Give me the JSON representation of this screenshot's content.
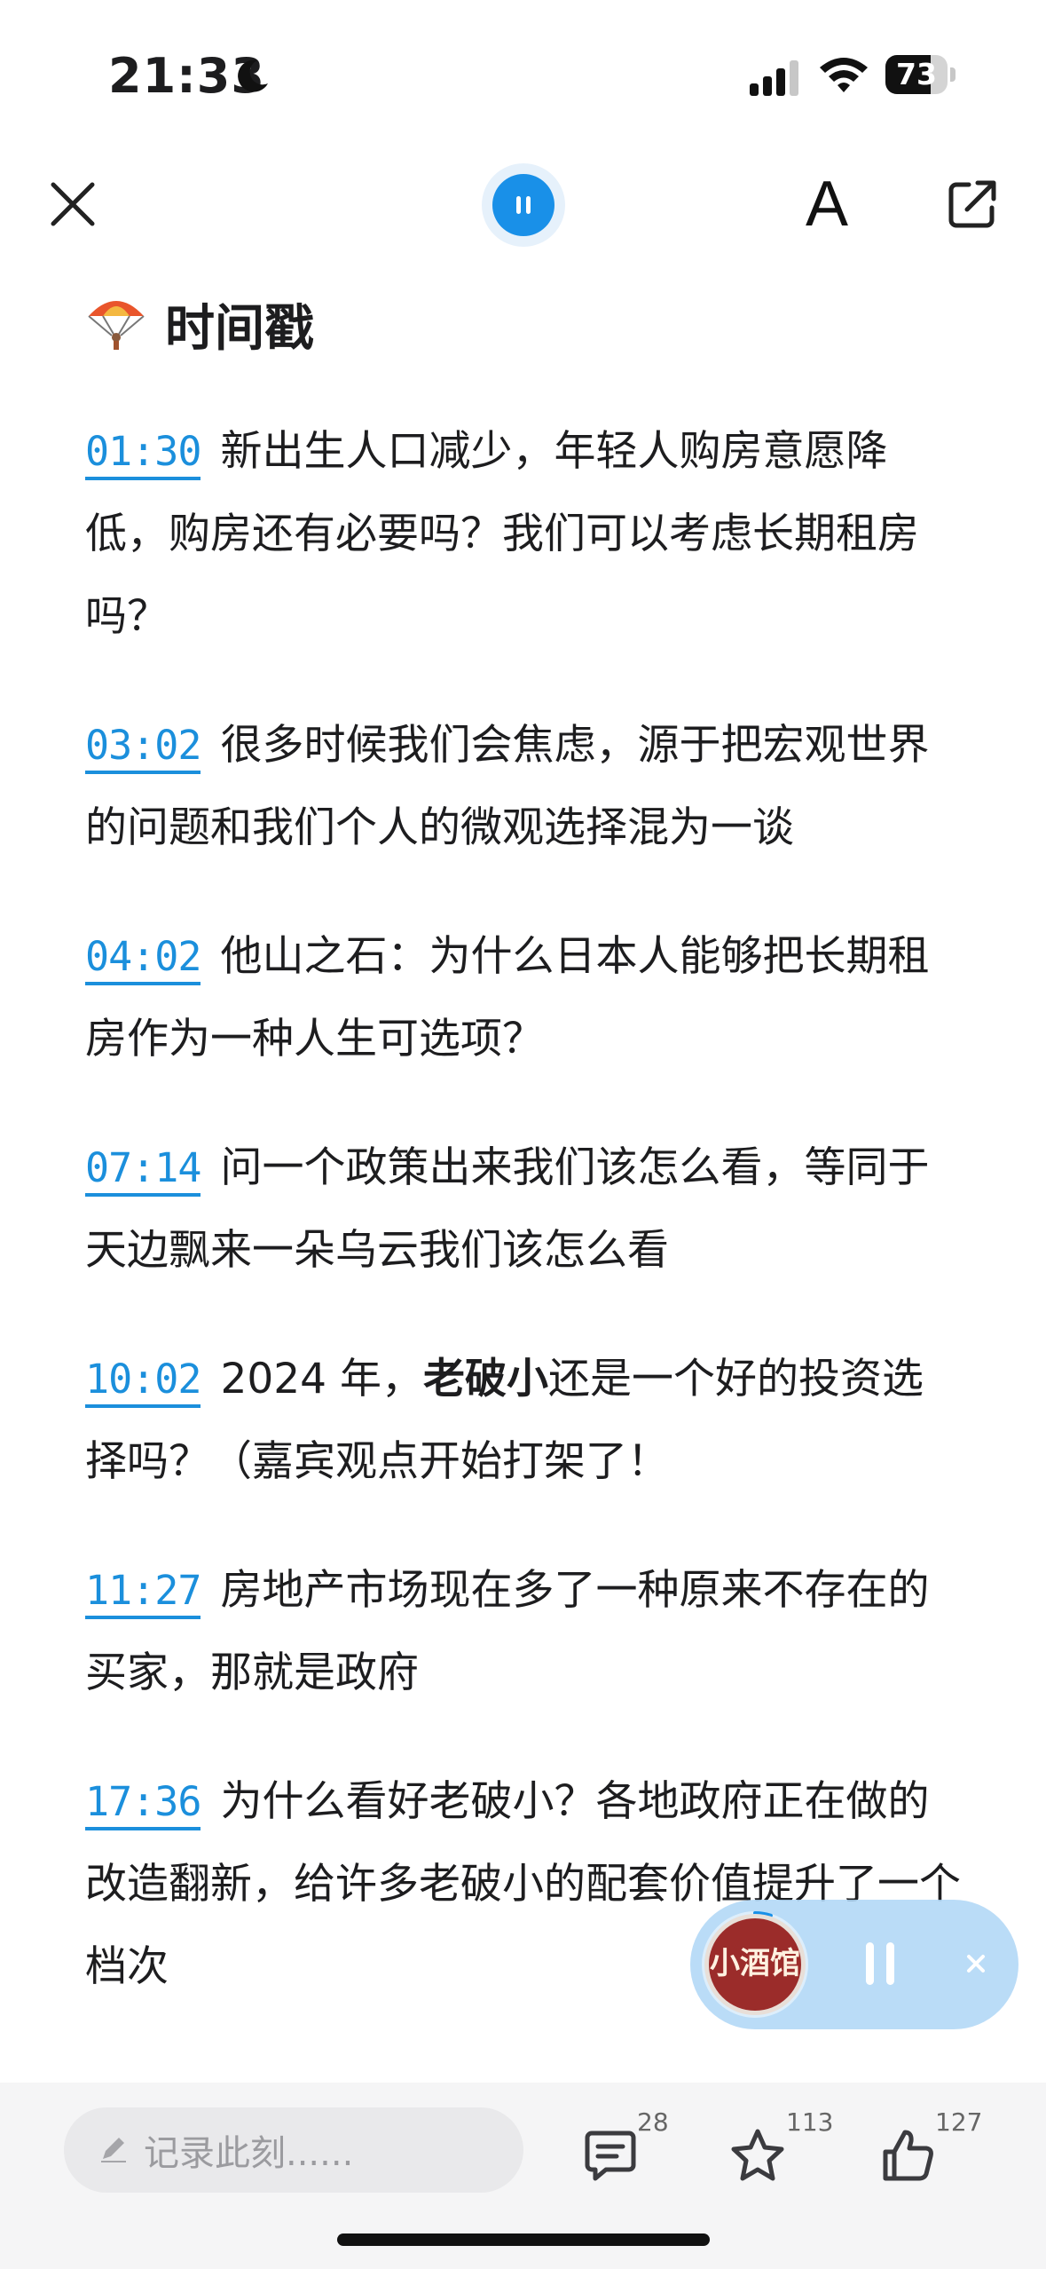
{
  "status_bar": {
    "time": "21:33",
    "battery": "73",
    "battery_level": 0.73
  },
  "nav": {
    "font_label": "A"
  },
  "section": {
    "title": "时间戳"
  },
  "timestamps": [
    {
      "time": "01:30",
      "text": "新出生人口减少，年轻人购房意愿降低，购房还有必要吗？我们可以考虑长期租房吗？"
    },
    {
      "time": "03:02",
      "text": "很多时候我们会焦虑，源于把宏观世界的问题和我们个人的微观选择混为一谈"
    },
    {
      "time": "04:02",
      "text": "他山之石：为什么日本人能够把长期租房作为一种人生可选项？"
    },
    {
      "time": "07:14",
      "text": "问一个政策出来我们该怎么看，等同于天边飘来一朵乌云我们该怎么看"
    },
    {
      "time": "10:02",
      "text_before": "2024 年，",
      "text_bold": "老破小",
      "text_after": "还是一个好的投资选择吗？（嘉宾观点开始打架了！"
    },
    {
      "time": "11:27",
      "text": "房地产市场现在多了一种原来不存在的买家，那就是政府"
    },
    {
      "time": "17:36",
      "text": "为什么看好老破小？各地政府正在做的改造翻新，给许多老破小的配套价值提升了一个档次"
    }
  ],
  "mini_player": {
    "cover_text": "小酒馆",
    "progress": 0.05
  },
  "bottom_bar": {
    "note_placeholder": "记录此刻......",
    "comments": "28",
    "stars": "113",
    "likes": "127"
  }
}
